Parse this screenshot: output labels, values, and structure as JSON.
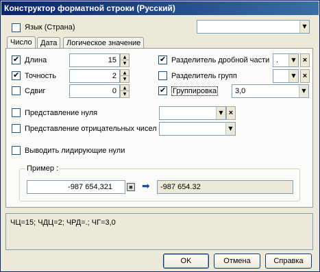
{
  "window": {
    "title": "Конструктор форматной строки (Русский)"
  },
  "language": {
    "label": "Язык (Страна)",
    "checked": false,
    "value": ""
  },
  "tabs": [
    {
      "label": "Число",
      "active": true
    },
    {
      "label": "Дата",
      "active": false
    },
    {
      "label": "Логическое значение",
      "active": false
    }
  ],
  "number": {
    "length": {
      "label": "Длина",
      "checked": true,
      "value": "15"
    },
    "precision": {
      "label": "Точность",
      "checked": true,
      "value": "2"
    },
    "shift": {
      "label": "Сдвиг",
      "checked": false,
      "value": "0"
    },
    "decimal_separator": {
      "label": "Разделитель дробной части",
      "checked": true,
      "value": "."
    },
    "group_separator": {
      "label": "Разделитель групп",
      "checked": false,
      "value": ""
    },
    "grouping": {
      "label": "Группировка",
      "checked": true,
      "value": "3,0"
    },
    "zero_repr": {
      "label": "Представление нуля",
      "checked": false,
      "value": ""
    },
    "negative_repr": {
      "label": "Представление отрицательных чисел",
      "checked": false,
      "value": ""
    },
    "leading_zeros": {
      "label": "Выводить лидирующие нули",
      "checked": false
    }
  },
  "example": {
    "title": "Пример :",
    "input_value": "-987 654,321",
    "result_value": "-987 654.32"
  },
  "summary": "ЧЦ=15; ЧДЦ=2; ЧРД=.; ЧГ=3,0",
  "buttons": {
    "ok": "OK",
    "cancel": "Отмена",
    "help": "Справка"
  }
}
